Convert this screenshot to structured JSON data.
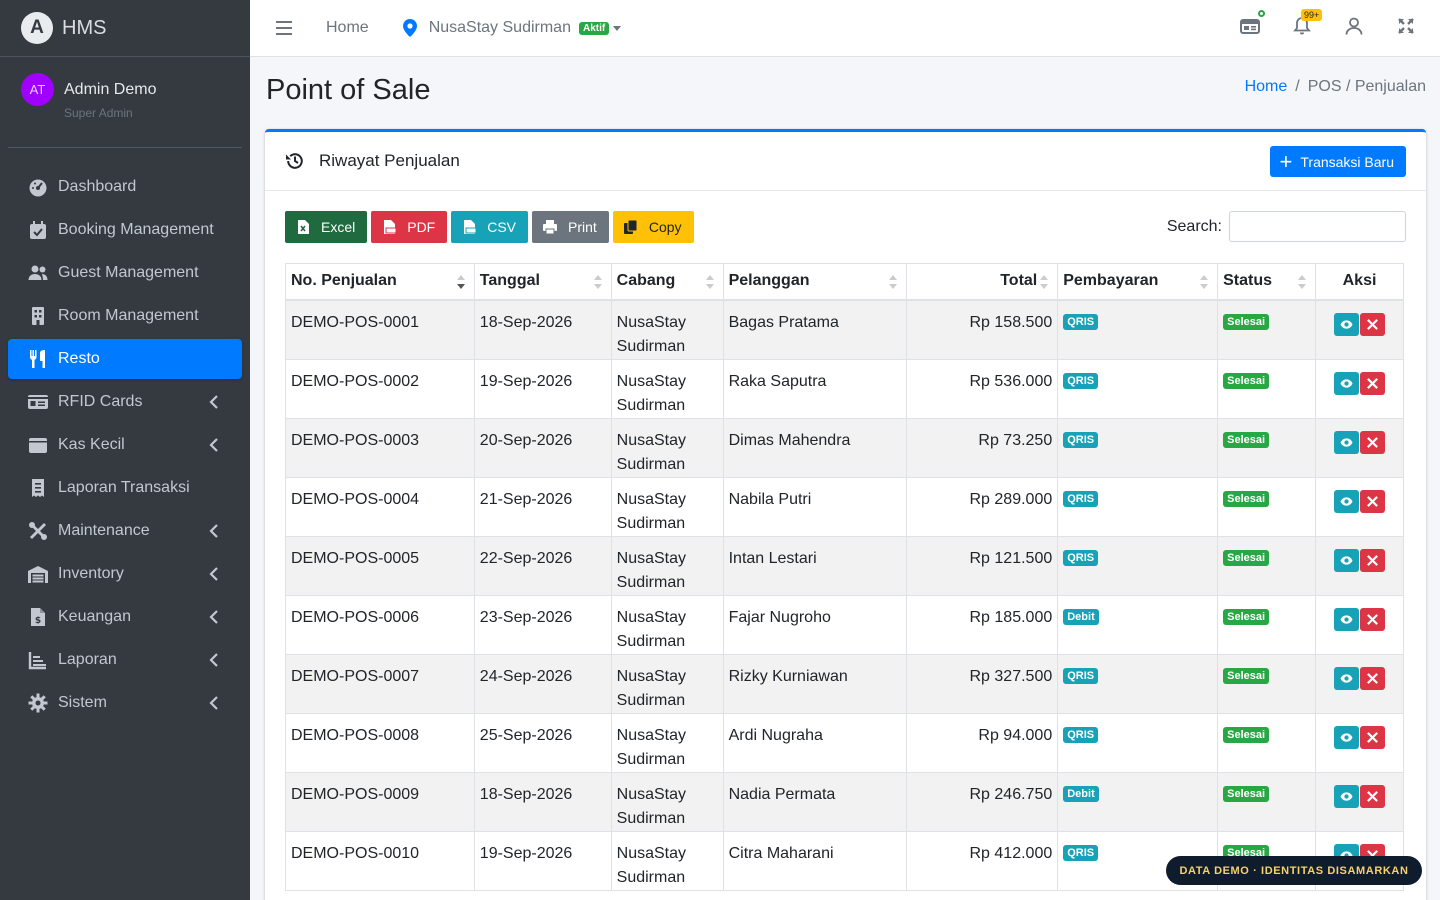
{
  "brand": {
    "name": "HMS",
    "logo_letter": "A"
  },
  "user": {
    "initials": "AT",
    "name": "Admin Demo",
    "role": "Super Admin"
  },
  "sidebar": {
    "items": [
      {
        "label": "Dashboard",
        "icon": "gauge-icon",
        "has_submenu": false,
        "active": false
      },
      {
        "label": "Booking Management",
        "icon": "calendar-check-icon",
        "has_submenu": false,
        "active": false
      },
      {
        "label": "Guest Management",
        "icon": "users-icon",
        "has_submenu": false,
        "active": false
      },
      {
        "label": "Room Management",
        "icon": "building-icon",
        "has_submenu": false,
        "active": false
      },
      {
        "label": "Resto",
        "icon": "utensils-icon",
        "has_submenu": false,
        "active": true
      },
      {
        "label": "RFID Cards",
        "icon": "id-card-icon",
        "has_submenu": true,
        "active": false
      },
      {
        "label": "Kas Kecil",
        "icon": "wallet-icon",
        "has_submenu": true,
        "active": false
      },
      {
        "label": "Laporan Transaksi",
        "icon": "receipt-icon",
        "has_submenu": false,
        "active": false
      },
      {
        "label": "Maintenance",
        "icon": "tools-icon",
        "has_submenu": true,
        "active": false
      },
      {
        "label": "Inventory",
        "icon": "warehouse-icon",
        "has_submenu": true,
        "active": false
      },
      {
        "label": "Keuangan",
        "icon": "file-invoice-dollar-icon",
        "has_submenu": true,
        "active": false
      },
      {
        "label": "Laporan",
        "icon": "chart-line-icon",
        "has_submenu": true,
        "active": false
      },
      {
        "label": "Sistem",
        "icon": "gear-icon",
        "has_submenu": true,
        "active": false
      }
    ]
  },
  "topbar": {
    "home": "Home",
    "hotel": "NusaStay Sudirman",
    "hotel_status": "Aktif",
    "notif_count": "99+"
  },
  "header": {
    "title": "Point of Sale",
    "breadcrumb": {
      "home": "Home",
      "trail": "POS / Penjualan"
    }
  },
  "card": {
    "title": "Riwayat Penjualan",
    "new_button": "Transaksi Baru"
  },
  "toolbar": {
    "excel": "Excel",
    "pdf": "PDF",
    "csv": "CSV",
    "print": "Print",
    "copy": "Copy",
    "search_label": "Search:",
    "search_value": ""
  },
  "table": {
    "columns": [
      "No. Penjualan",
      "Tanggal",
      "Cabang",
      "Pelanggan",
      "Total",
      "Pembayaran",
      "Status",
      "Aksi"
    ],
    "rows": [
      {
        "no": "DEMO-POS-0001",
        "tanggal": "18-Sep-2026",
        "cabang1": "NusaStay",
        "cabang2": "Sudirman",
        "pelanggan": "Bagas Pratama",
        "total": "Rp 158.500",
        "bayar": "QRIS",
        "status": "Selesai"
      },
      {
        "no": "DEMO-POS-0002",
        "tanggal": "19-Sep-2026",
        "cabang1": "NusaStay",
        "cabang2": "Sudirman",
        "pelanggan": "Raka Saputra",
        "total": "Rp 536.000",
        "bayar": "QRIS",
        "status": "Selesai"
      },
      {
        "no": "DEMO-POS-0003",
        "tanggal": "20-Sep-2026",
        "cabang1": "NusaStay",
        "cabang2": "Sudirman",
        "pelanggan": "Dimas Mahendra",
        "total": "Rp 73.250",
        "bayar": "QRIS",
        "status": "Selesai"
      },
      {
        "no": "DEMO-POS-0004",
        "tanggal": "21-Sep-2026",
        "cabang1": "NusaStay",
        "cabang2": "Sudirman",
        "pelanggan": "Nabila Putri",
        "total": "Rp 289.000",
        "bayar": "QRIS",
        "status": "Selesai"
      },
      {
        "no": "DEMO-POS-0005",
        "tanggal": "22-Sep-2026",
        "cabang1": "NusaStay",
        "cabang2": "Sudirman",
        "pelanggan": "Intan Lestari",
        "total": "Rp 121.500",
        "bayar": "QRIS",
        "status": "Selesai"
      },
      {
        "no": "DEMO-POS-0006",
        "tanggal": "23-Sep-2026",
        "cabang1": "NusaStay",
        "cabang2": "Sudirman",
        "pelanggan": "Fajar Nugroho",
        "total": "Rp 185.000",
        "bayar": "Debit",
        "status": "Selesai"
      },
      {
        "no": "DEMO-POS-0007",
        "tanggal": "24-Sep-2026",
        "cabang1": "NusaStay",
        "cabang2": "Sudirman",
        "pelanggan": "Rizky Kurniawan",
        "total": "Rp 327.500",
        "bayar": "QRIS",
        "status": "Selesai"
      },
      {
        "no": "DEMO-POS-0008",
        "tanggal": "25-Sep-2026",
        "cabang1": "NusaStay",
        "cabang2": "Sudirman",
        "pelanggan": "Ardi Nugraha",
        "total": "Rp 94.000",
        "bayar": "QRIS",
        "status": "Selesai"
      },
      {
        "no": "DEMO-POS-0009",
        "tanggal": "18-Sep-2026",
        "cabang1": "NusaStay",
        "cabang2": "Sudirman",
        "pelanggan": "Nadia Permata",
        "total": "Rp 246.750",
        "bayar": "Debit",
        "status": "Selesai"
      },
      {
        "no": "DEMO-POS-0010",
        "tanggal": "19-Sep-2026",
        "cabang1": "NusaStay",
        "cabang2": "Sudirman",
        "pelanggan": "Citra Maharani",
        "total": "Rp 412.000",
        "bayar": "QRIS",
        "status": "Selesai"
      }
    ]
  },
  "demo_badge": "DATA DEMO · IDENTITAS DISAMARKAN",
  "colors": {
    "primary": "#007bff",
    "sidebar": "#343a40",
    "success": "#28a745",
    "info": "#17a2b8",
    "danger": "#dc3545",
    "warning": "#ffc107"
  }
}
